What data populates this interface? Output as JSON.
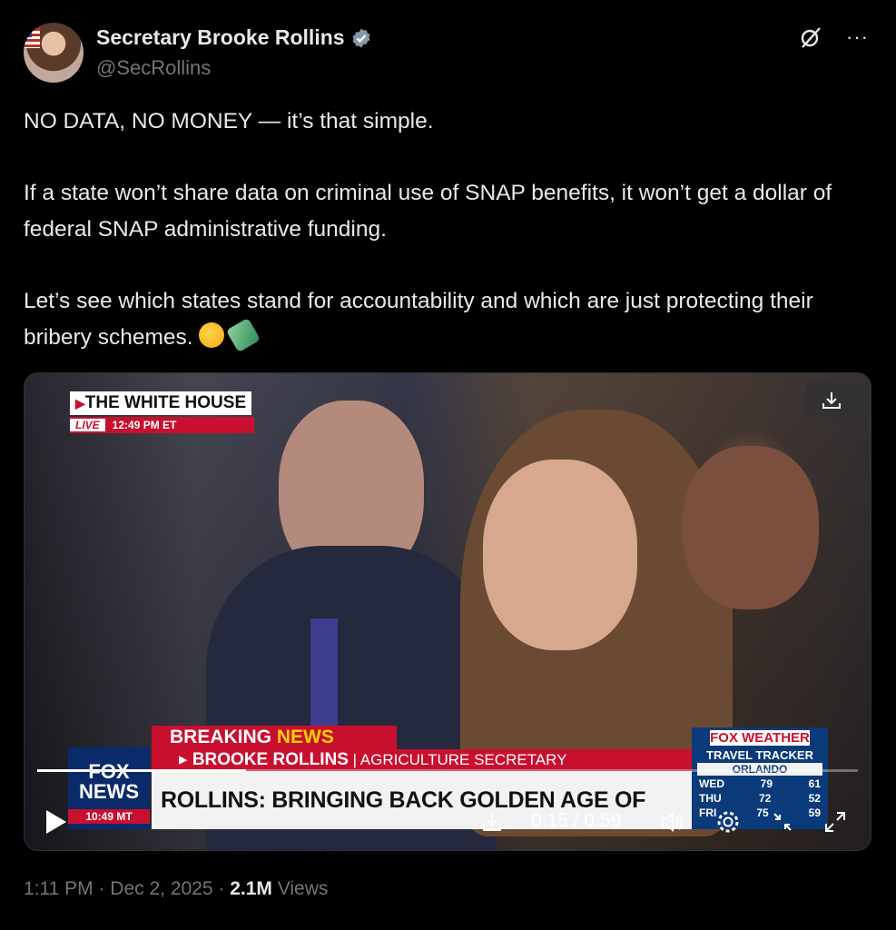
{
  "author": {
    "display_name": "Secretary Brooke Rollins",
    "handle": "@SecRollins",
    "verified_badge_color": "#1d9bf0"
  },
  "top_icons": {
    "grok": "grok-icon",
    "more": "···"
  },
  "tweet": {
    "line1": "NO DATA, NO MONEY — it’s that simple.",
    "line2": "If a state won’t share data on criminal use of SNAP benefits, it won’t get a dollar of federal SNAP administrative funding.",
    "line3": "Let’s see which states stand for accountability and which are just protecting their bribery schemes."
  },
  "video": {
    "overlay_tag": "THE WHITE HOUSE",
    "live_label": "LIVE",
    "live_time": "12:49 PM ET",
    "breaking_1": "BREAKING ",
    "breaking_2": "NEWS",
    "sub_name": "▸ BROOKE ROLLINS",
    "sub_rest": " | AGRICULTURE SECRETARY",
    "headline": "ROLLINS: BRINGING BACK GOLDEN AGE OF RURAL AMERICA",
    "network_1": "FOX",
    "network_2": "NEWS",
    "network_time": "10:49 MT",
    "weather_brand": "FOX WEATHER",
    "weather_title": "TRAVEL TRACKER",
    "weather_city": "ORLANDO",
    "weather_rows": [
      {
        "day": "WED",
        "hi": "79",
        "lo": "61"
      },
      {
        "day": "THU",
        "hi": "72",
        "lo": "52"
      },
      {
        "day": "FRI",
        "hi": "75",
        "lo": "59"
      }
    ],
    "time_readout": "0:15 / 0:59",
    "progress_fraction": 0.254
  },
  "meta": {
    "time": "1:11 PM · Dec 2, 2025 · ",
    "views_count": "2.1M",
    "views_label": " Views"
  },
  "colors": {
    "accent_red": "#c8102e",
    "fox_blue": "#0a2a6a",
    "muted": "#71767b"
  }
}
